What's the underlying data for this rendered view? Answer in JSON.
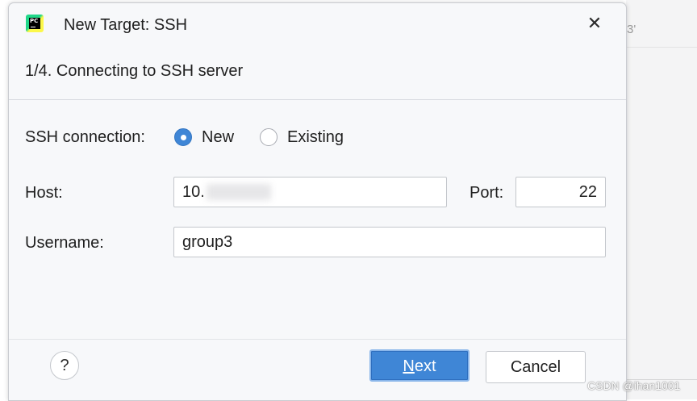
{
  "dialog": {
    "title": "New Target: SSH",
    "close_symbol": "✕",
    "step": "1/4. Connecting to SSH server"
  },
  "background": {
    "partial_text": "3'"
  },
  "form": {
    "connection_label": "SSH connection:",
    "options": [
      {
        "label": "New",
        "selected": true
      },
      {
        "label": "Existing",
        "selected": false
      }
    ],
    "host_label": "Host:",
    "host_value": "10.",
    "port_label": "Port:",
    "port_value": "22",
    "username_label": "Username:",
    "username_value": "group3"
  },
  "footer": {
    "help_symbol": "?",
    "next_mnemonic": "N",
    "next_rest": "ext",
    "cancel_label": "Cancel"
  },
  "watermark": "CSDN @ihan1001",
  "colors": {
    "accent": "#3f86d6",
    "dialog_bg": "#f7f8fa"
  }
}
